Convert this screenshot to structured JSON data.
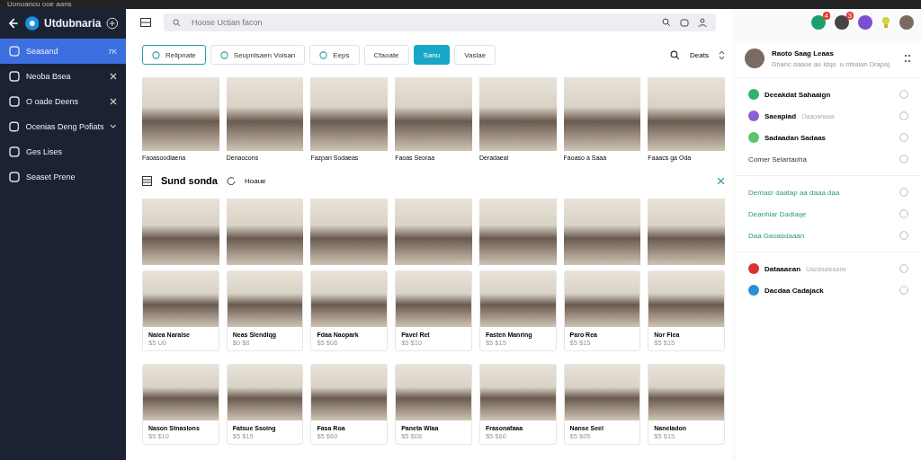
{
  "window": {
    "title": "Uonoancu ooe aans"
  },
  "sidebar": {
    "brand": "Utdubnaria",
    "items": [
      {
        "label": "Seasand",
        "badge": "7K",
        "selected": true,
        "kind": "badge"
      },
      {
        "label": "Neoba Bsea",
        "selected": false,
        "kind": "close"
      },
      {
        "label": "O oade Deens",
        "selected": false,
        "kind": "close"
      },
      {
        "label": "Ocenias Deng Pofiats",
        "selected": false,
        "kind": "expand"
      },
      {
        "label": "Ges Lises",
        "selected": false,
        "kind": "plain"
      },
      {
        "label": "Seaset Prene",
        "selected": false,
        "kind": "plain"
      }
    ]
  },
  "search": {
    "placeholder": "Hoose Uctian facon"
  },
  "filters": [
    {
      "label": "Relipnate",
      "selected": false,
      "kind": "icon"
    },
    {
      "label": "Seupnlsaen Voisan",
      "selected": false,
      "kind": "icon"
    },
    {
      "label": "Eeps",
      "selected": false,
      "kind": "icon"
    },
    {
      "label": "Cfaoate",
      "selected": false,
      "kind": "plain"
    },
    {
      "label": "Sanu",
      "selected": true,
      "kind": "plain"
    },
    {
      "label": "Vaslae",
      "selected": false,
      "kind": "plain"
    }
  ],
  "sort_label": "Deats",
  "hero": [
    "Faoasoodiaena",
    "Denaocons",
    "Fazpan Sodaeas",
    "Faoas Seoraa",
    "Deradaeal",
    "Faoaso a Saaa",
    "Faaacs ga Oda"
  ],
  "section": {
    "title": "Sund sonda",
    "subtitle": "Hoaue"
  },
  "grid_rows": [
    {
      "tiles": [
        {
          "title": "Naiea Naralse",
          "meta": "$5 U0"
        },
        {
          "title": "Neas Slendiqg",
          "meta": "$0 $8"
        },
        {
          "title": "Fdaa Naopark",
          "meta": "$5 $06"
        },
        {
          "title": "Pavel Ret",
          "meta": "$5 $10"
        },
        {
          "title": "Fasten Manring",
          "meta": "$5 $15"
        },
        {
          "title": "Paro Rea",
          "meta": "$5 $15"
        },
        {
          "title": "Nor Flea",
          "meta": "$5 $15"
        }
      ]
    },
    {
      "tiles": [
        {
          "title": "Nason Stnaslons",
          "meta": "$5 $10"
        },
        {
          "title": "Fatsue Ssoing",
          "meta": "$5 $15"
        },
        {
          "title": "Fasa Roa",
          "meta": "$5 $60"
        },
        {
          "title": "Paneta Wlaa",
          "meta": "$5 $08"
        },
        {
          "title": "Frasonafaaa",
          "meta": "$5 $60"
        },
        {
          "title": "Nanse Seel",
          "meta": "$5 $05"
        },
        {
          "title": "Naneladon",
          "meta": "$5 $15"
        }
      ]
    }
  ],
  "top_icons": [
    {
      "badge": "4",
      "color": "#1e9e6a"
    },
    {
      "badge": "3",
      "color": "#444444"
    },
    {
      "color": "#7a4fd0"
    }
  ],
  "profile": {
    "name": "Raoto Saag Leaas",
    "subtitle": "Dhanc daaoe ao Idqo",
    "note": "u mbaian Drapa)"
  },
  "panel_groups": [
    {
      "items": [
        {
          "label": "Deeakdat Sahaaign",
          "kind": "app",
          "color": "#2fb36c"
        },
        {
          "label": "Saeapiad",
          "hint": "Oaaoanaaa",
          "kind": "app",
          "color": "#8a5ed8"
        },
        {
          "label": "Sadaadan Sadaas",
          "kind": "app",
          "color": "#5cc46a"
        },
        {
          "label": "Comer Selartaoha",
          "kind": "text"
        }
      ]
    },
    {
      "items": [
        {
          "label": "Demasr daatap aa daaa daa",
          "kind": "link"
        },
        {
          "label": "Deanhiar Dadiaqe",
          "kind": "link"
        },
        {
          "label": "Daa Daoasdaaan",
          "kind": "link"
        }
      ]
    },
    {
      "items": [
        {
          "label": "Dataaaean",
          "hint": "Uacdaaieaane",
          "kind": "app",
          "color": "#d63434"
        },
        {
          "label": "Dacdaa Cadajack",
          "kind": "app",
          "color": "#2a8fd8"
        }
      ]
    }
  ]
}
